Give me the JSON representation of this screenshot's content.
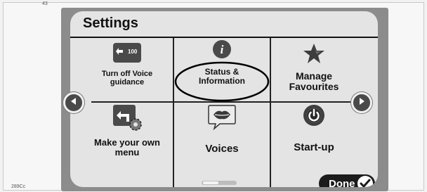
{
  "page_marks": {
    "top_left": "43",
    "bottom_left": "289Cc"
  },
  "screen": {
    "title": "Settings"
  },
  "tiles": [
    {
      "label": "Turn off Voice guidance",
      "icon": "voice-guidance-icon",
      "badge": "100"
    },
    {
      "label": "Status & Information",
      "icon": "info-icon",
      "highlighted": true
    },
    {
      "label": "Manage Favourites",
      "icon": "star-icon"
    },
    {
      "label": "Make your own menu",
      "icon": "custom-menu-icon"
    },
    {
      "label": "Voices",
      "icon": "lips-speech-icon"
    },
    {
      "label": "Start-up",
      "icon": "power-icon"
    }
  ],
  "nav": {
    "prev_icon": "chevron-left-icon",
    "next_icon": "chevron-right-icon"
  },
  "done_button": {
    "label": "Done",
    "icon": "checkmark-icon"
  },
  "pager": {
    "pages": 2,
    "current": 1
  },
  "colors": {
    "tile_icon_bg": "#4a4a4a",
    "highlight_ring": "#000000",
    "screen_bg": "#e4e4e4",
    "done_bg": "#1b1b1b"
  }
}
